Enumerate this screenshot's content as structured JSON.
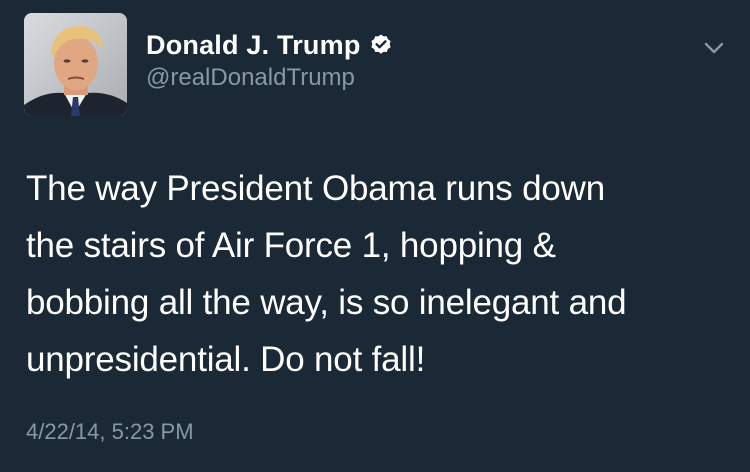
{
  "tweet": {
    "author": {
      "display_name": "Donald J. Trump",
      "handle": "@realDonaldTrump",
      "verified": true,
      "avatar_icon": "profile-photo"
    },
    "text_lines": [
      "The way President Obama runs down",
      "the stairs of Air Force 1, hopping &",
      "bobbing all the way, is so inelegant and",
      "unpresidential. Do not fall!"
    ],
    "timestamp": "4/22/14, 5:23 PM",
    "menu_icon": "chevron-down-icon"
  },
  "colors": {
    "background": "#1b2836",
    "text_primary": "#ffffff",
    "text_secondary": "#8899a6",
    "verified_badge": "#ffffff"
  }
}
